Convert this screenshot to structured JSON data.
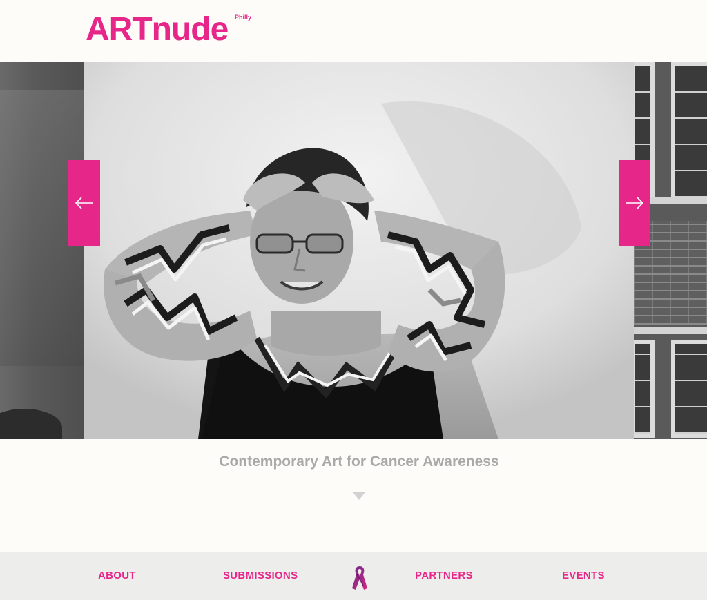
{
  "brand": {
    "name": "ARTnude",
    "sub": "Philly",
    "accent_color": "#e7268a"
  },
  "slider": {
    "prev_icon": "arrow-left-icon",
    "next_icon": "arrow-right-icon"
  },
  "caption": "Contemporary Art for Cancer Awareness",
  "nav": {
    "about": "ABOUT",
    "submissions": "SUBMISSIONS",
    "partners": "PARTNERS",
    "events": "EVENTS",
    "center_icon": "awareness-ribbon-icon"
  }
}
